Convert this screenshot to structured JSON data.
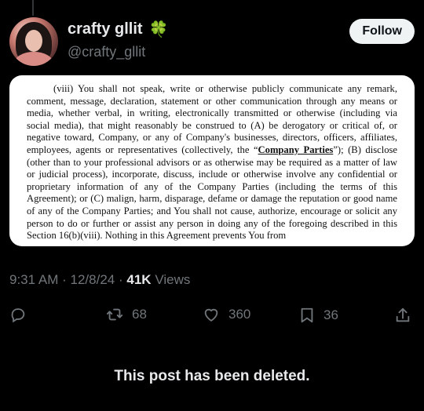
{
  "thread": {
    "connector": ""
  },
  "author": {
    "display_name": "crafty gllit",
    "badge_emoji": "🍀",
    "handle": "@crafty_gllit"
  },
  "follow_button": {
    "label": "Follow"
  },
  "document": {
    "paragraph_start": "(viii) You shall not speak, write or otherwise publicly communicate any remark, comment, message, declaration, statement or other communication through any means or media, whether verbal, in writing, electronically transmitted or otherwise (including via social media), that might reasonably be construed to (A) be derogatory or critical of, or negative toward, Company, or any of Company's businesses, directors, officers, affiliates, employees, agents or representatives (collectively, the “",
    "defined_term": "Company Parties",
    "paragraph_end": "”); (B) disclose (other than to your professional advisors or as otherwise may be required as a matter of law or judicial process), incorporate, discuss, include or otherwise involve any confidential or proprietary information of any of the Company Parties (including the terms of this Agreement); or (C) malign, harm, disparage, defame or damage the reputation or good name of any of the Company Parties; and You shall not cause, authorize, encourage or solicit any person to do or further or assist any person in doing any of the foregoing described in this Section 16(b)(viii). Nothing in this Agreement prevents You from"
  },
  "meta": {
    "time": "9:31 AM",
    "separator": "·",
    "date": "12/8/24",
    "views_count": "41K",
    "views_label": "Views"
  },
  "actions": {
    "reposts": "68",
    "likes": "360",
    "bookmarks": "36"
  },
  "notice": "This post has been deleted.",
  "colors": {
    "background": "#000000",
    "text_primary": "#e7e9ea",
    "text_secondary": "#71767b",
    "follow_bg": "#eff3f4"
  }
}
